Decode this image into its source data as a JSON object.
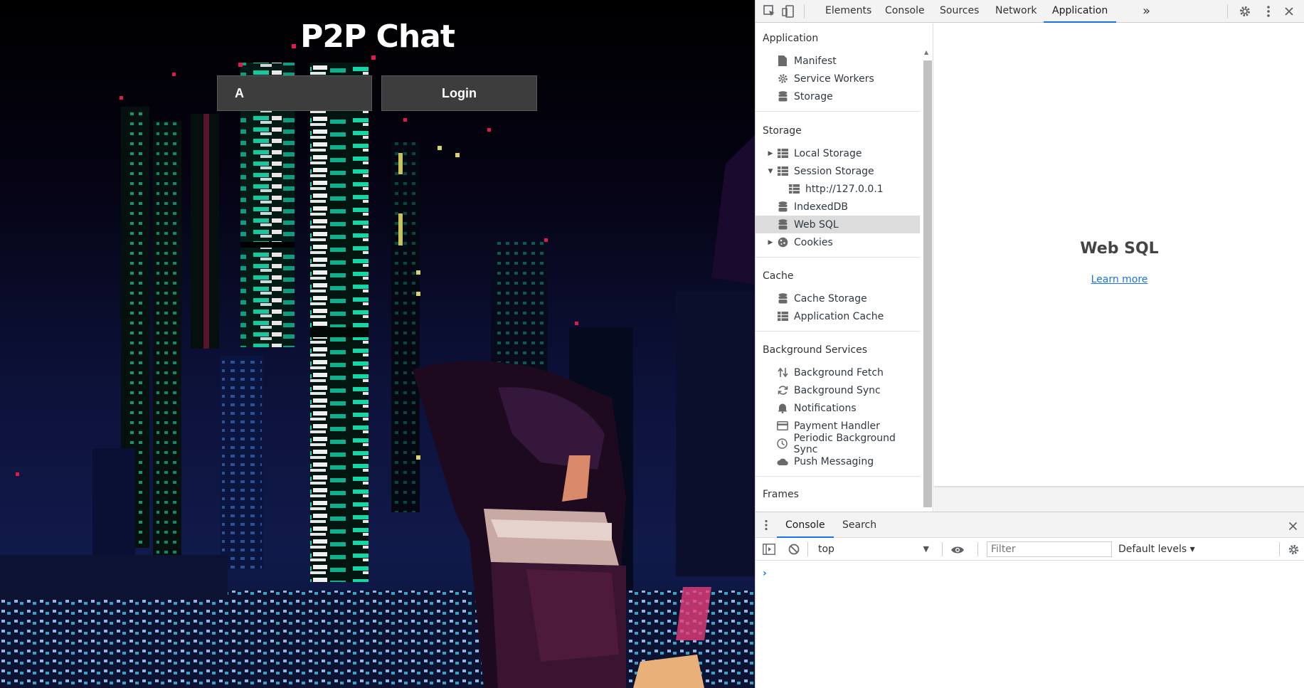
{
  "page": {
    "title": "P2P Chat",
    "name_input_value": "A",
    "login_label": "Login"
  },
  "devtools": {
    "tabs": [
      {
        "label": "Elements",
        "active": false
      },
      {
        "label": "Console",
        "active": false
      },
      {
        "label": "Sources",
        "active": false
      },
      {
        "label": "Network",
        "active": false
      },
      {
        "label": "Application",
        "active": true
      }
    ],
    "more_tabs_glyph": "»",
    "sidebar": {
      "sections": [
        {
          "heading": "Application",
          "items": [
            {
              "label": "Manifest",
              "icon": "file-icon"
            },
            {
              "label": "Service Workers",
              "icon": "gear-icon"
            },
            {
              "label": "Storage",
              "icon": "database-icon"
            }
          ]
        },
        {
          "heading": "Storage",
          "items": [
            {
              "label": "Local Storage",
              "icon": "grid-icon",
              "expand": "collapsed"
            },
            {
              "label": "Session Storage",
              "icon": "grid-icon",
              "expand": "expanded"
            },
            {
              "label": "http://127.0.0.1",
              "icon": "grid-icon",
              "child": true
            },
            {
              "label": "IndexedDB",
              "icon": "database-icon"
            },
            {
              "label": "Web SQL",
              "icon": "database-icon",
              "selected": true
            },
            {
              "label": "Cookies",
              "icon": "cookie-icon",
              "expand": "collapsed"
            }
          ]
        },
        {
          "heading": "Cache",
          "items": [
            {
              "label": "Cache Storage",
              "icon": "database-icon"
            },
            {
              "label": "Application Cache",
              "icon": "grid-icon"
            }
          ]
        },
        {
          "heading": "Background Services",
          "items": [
            {
              "label": "Background Fetch",
              "icon": "arrows-updown-icon"
            },
            {
              "label": "Background Sync",
              "icon": "sync-icon"
            },
            {
              "label": "Notifications",
              "icon": "bell-icon"
            },
            {
              "label": "Payment Handler",
              "icon": "card-icon"
            },
            {
              "label": "Periodic Background Sync",
              "icon": "clock-icon"
            },
            {
              "label": "Push Messaging",
              "icon": "cloud-icon"
            }
          ]
        },
        {
          "heading": "Frames",
          "items": []
        }
      ]
    },
    "panel": {
      "title": "Web SQL",
      "link": "Learn more"
    },
    "drawer": {
      "tabs": [
        {
          "label": "Console",
          "active": true
        },
        {
          "label": "Search",
          "active": false
        }
      ],
      "context": "top",
      "filter_placeholder": "Filter",
      "levels": "Default levels ▾",
      "prompt": "›"
    }
  },
  "colors": {
    "accent": "#1a73e8",
    "selected_row": "#dcdcdc",
    "button_bg": "#3d3d3d"
  }
}
